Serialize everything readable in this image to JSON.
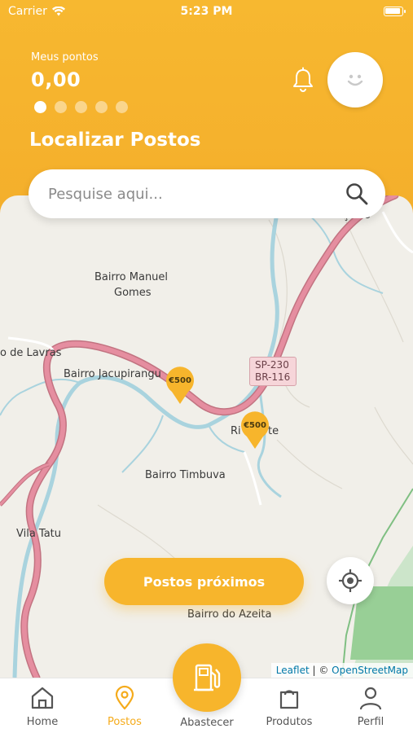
{
  "status_bar": {
    "carrier": "Carrier",
    "time": "5:23 PM"
  },
  "header": {
    "points_label": "Meus pontos",
    "points_value": "0,00",
    "carousel_dots": 5,
    "carousel_active_index": 0,
    "title": "Localizar Postos"
  },
  "search": {
    "placeholder": "Pesquise aqui..."
  },
  "map": {
    "labels": {
      "manuel_gomes_1": "Bairro Manuel",
      "manuel_gomes_2": "Gomes",
      "lavras": "o de Lavras",
      "jacupiranga": "Bairro Jacupirangu",
      "rio_part1": "Ri",
      "rio_part2": "te",
      "timbuva": "Bairro Timbuva",
      "vila_tatu": "Vila Tatu",
      "azeita": "Bairro do Azeita",
      "top_cut": "Bairro Gonçalos"
    },
    "road_shield": {
      "line1": "SP-230",
      "line2": "BR-116"
    },
    "station_pin_label": "€500",
    "attribution": {
      "leaflet": "Leaflet",
      "separator": " | © ",
      "osm": "OpenStreetMap"
    }
  },
  "buttons": {
    "nearby": "Postos próximos"
  },
  "tabbar": {
    "tabs": [
      {
        "label": "Home",
        "icon": "home-icon"
      },
      {
        "label": "Postos",
        "icon": "location-pin-icon"
      },
      {
        "label": "Abastecer",
        "icon": "fuel-pump-icon"
      },
      {
        "label": "Produtos",
        "icon": "shopping-bag-icon"
      },
      {
        "label": "Perfil",
        "icon": "user-icon"
      }
    ],
    "active_index": 1
  },
  "colors": {
    "accent": "#F7B52C",
    "active_tab": "#F5AB1B",
    "map_bg": "#F1EFE9",
    "road": "#E2889A",
    "river": "#A9D3DE",
    "forest": "#8CC78E"
  }
}
